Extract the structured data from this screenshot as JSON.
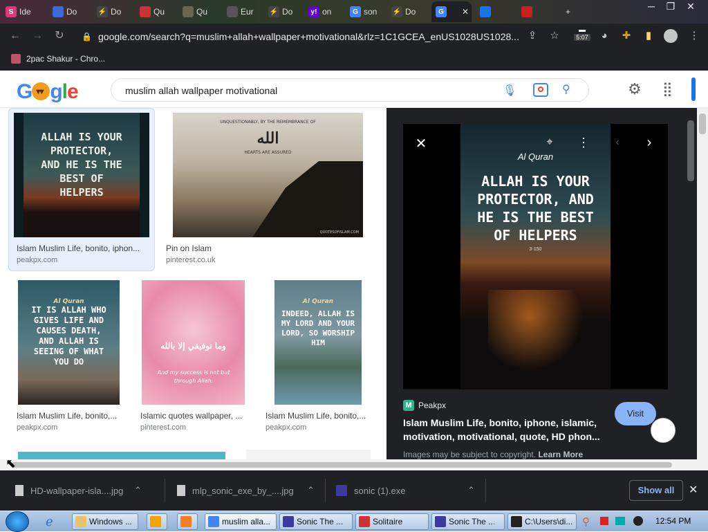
{
  "browser": {
    "tabs": [
      {
        "label": "Ide",
        "fav": "S",
        "favColor": "#d93a7a"
      },
      {
        "label": "Do",
        "fav": "",
        "favColor": "#3a6ad9"
      },
      {
        "label": "Do",
        "fav": "⚡",
        "favColor": "#444"
      },
      {
        "label": "Qu",
        "fav": "",
        "favColor": "#c33"
      },
      {
        "label": "Qu",
        "fav": "",
        "favColor": "#665"
      },
      {
        "label": "Eur",
        "fav": "",
        "favColor": "#555"
      },
      {
        "label": "Do",
        "fav": "⚡",
        "favColor": "#444"
      },
      {
        "label": "on",
        "fav": "y!",
        "favColor": "#6001d2"
      },
      {
        "label": "son",
        "fav": "G",
        "favColor": "#4285f4"
      },
      {
        "label": "Do",
        "fav": "⚡",
        "favColor": "#444"
      },
      {
        "label": "",
        "fav": "G",
        "favColor": "#4285f4"
      },
      {
        "label": "",
        "fav": "",
        "favColor": "#1a73e8"
      },
      {
        "label": "",
        "fav": "",
        "favColor": "#c5221f"
      }
    ],
    "url": "google.com/search?q=muslim+allah+wallpaper+motivational&rlz=1C1GCEA_enUS1028US1028...",
    "clock_badge": "5:07",
    "bookmark": "2pac Shakur - Chro..."
  },
  "google": {
    "logo": "Google",
    "query": "muslim allah wallpaper motivational"
  },
  "results": [
    {
      "caption": "Islam Muslim Life, bonito, iphon...",
      "source": "peakpx.com",
      "art": "Allah is your protector, and he is the best of helpers"
    },
    {
      "caption": "Pin on Islam",
      "source": "pinterest.co.uk",
      "art_top": "Unquestionably, by the remembrance of",
      "art_mid": "Hearts are assured",
      "art_mark": "quotesofislam.com"
    },
    {
      "caption": "Islam Muslim Life, bonito,...",
      "source": "peakpx.com",
      "art_head": "Al Quran",
      "art": "It is Allah who gives life and causes death, and Allah is seeing of what you do"
    },
    {
      "caption": "Islamic quotes wallpaper, ...",
      "source": "pinterest.com",
      "art_bottom": "And my success is not but through Allah."
    },
    {
      "caption": "Islam Muslim Life, bonito,...",
      "source": "peakpx.com",
      "art_head": "Al Quran",
      "art": "Indeed, Allah is my Lord and your Lord, so worship him"
    }
  ],
  "preview": {
    "image_head": "Al Quran",
    "image_text": "Allah is your protector, and he is the best of helpers",
    "image_ref": "3-150",
    "site": "Peakpx",
    "title": "Islam Muslim Life, bonito, iphone, islamic, motivation, motivational, quote, HD phon...",
    "visit_label": "Visit",
    "copyright": "Images may be subject to copyright.",
    "learn_more": "Learn More"
  },
  "downloads": {
    "items": [
      "HD-wallpaper-isla....jpg",
      "mlp_sonic_exe_by_....jpg",
      "sonic (1).exe"
    ],
    "show_all": "Show all"
  },
  "taskbar": {
    "items": [
      {
        "label": "Windows ...",
        "color": "#e8c36a"
      },
      {
        "label": "",
        "color": "#f3a300"
      },
      {
        "label": "",
        "color": "#f47f22"
      },
      {
        "label": "muslim alla...",
        "color": "#4285f4"
      },
      {
        "label": "Sonic The ...",
        "color": "#3b3aa0"
      },
      {
        "label": "Solitaire",
        "color": "#c33"
      },
      {
        "label": "Sonic The ...",
        "color": "#3b3aa0"
      },
      {
        "label": "C:\\Users\\di...",
        "color": "#222"
      }
    ],
    "time": "12:54 PM"
  },
  "colors": {
    "accent": "#1a73e8",
    "visit": "#8ab4f8",
    "dark": "#202124"
  }
}
